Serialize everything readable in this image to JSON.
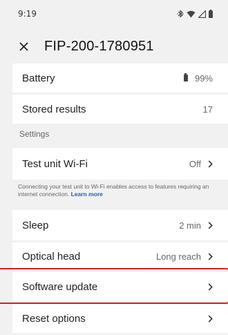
{
  "status_bar": {
    "time": "9:19",
    "icons": [
      "bluetooth-icon",
      "wifi-icon",
      "cell-signal-icon",
      "battery-icon"
    ]
  },
  "app_bar": {
    "close_icon": "close-icon",
    "title": "FIP-200-1780951"
  },
  "rows": {
    "battery": {
      "label": "Battery",
      "value": "99%"
    },
    "stored_results": {
      "label": "Stored results",
      "value": "17"
    },
    "settings_header": "Settings",
    "wifi": {
      "label": "Test unit Wi-Fi",
      "value": "Off"
    },
    "wifi_help": {
      "text": "Connecting your test unit to Wi-Fi enables access to features requiring an internet connection.",
      "link": "Learn more"
    },
    "sleep": {
      "label": "Sleep",
      "value": "2 min"
    },
    "optical_head": {
      "label": "Optical head",
      "value": "Long reach"
    },
    "software_update": {
      "label": "Software update"
    },
    "reset_options": {
      "label": "Reset options"
    }
  },
  "colors": {
    "background": "#f1f1f1",
    "card": "#ffffff",
    "link": "#1a5fb4",
    "highlight": "#d81e1e"
  }
}
